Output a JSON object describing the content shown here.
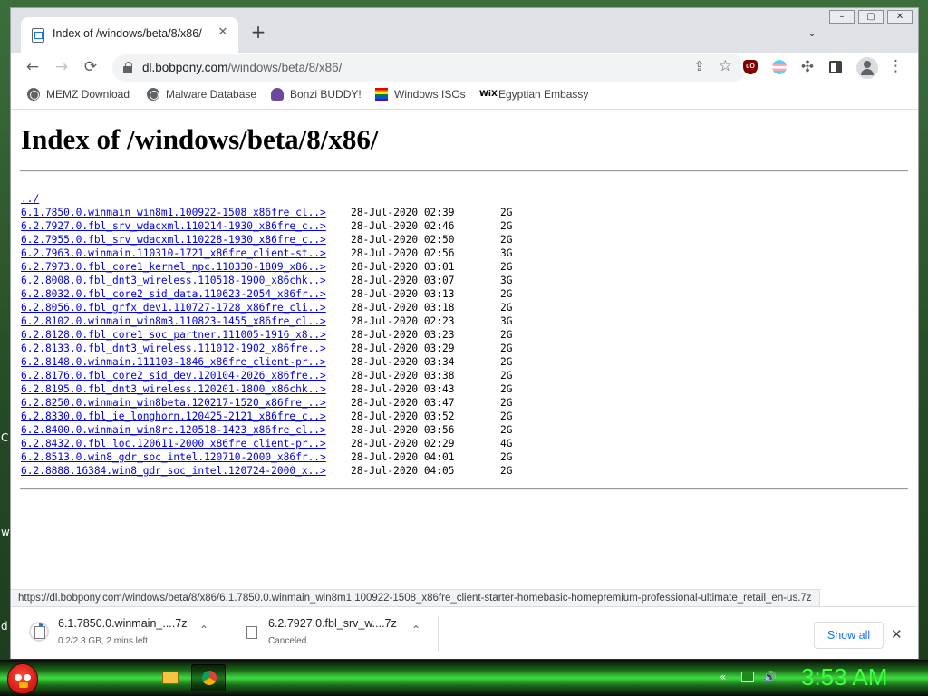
{
  "browser": {
    "tab": {
      "title": "Index of /windows/beta/8/x86/",
      "close": "✕"
    },
    "new_tab": "+",
    "tab_search": "⌄",
    "window_controls": {
      "minimize": "–",
      "maximize": "▢",
      "close": "✕"
    },
    "address": {
      "host": "dl.bobpony.com",
      "path": "/windows/beta/8/x86/"
    },
    "icons": {
      "back": "←",
      "forward": "→",
      "reload": "⟳",
      "share": "⇪",
      "star": "☆",
      "menu": "⋮",
      "puzzle": "✣"
    },
    "ublock_label": "uO",
    "bookmarks": [
      {
        "label": "MEMZ Download",
        "icon": "globe-icon"
      },
      {
        "label": "Malware Database",
        "icon": "globe-icon"
      },
      {
        "label": "Bonzi BUDDY!",
        "icon": "bonzi-icon"
      },
      {
        "label": "Windows ISOs",
        "icon": "rainbow-flag-icon"
      },
      {
        "label": "Egyptian Embassy",
        "icon": "wix-icon",
        "icon_text": "WiX"
      }
    ]
  },
  "page": {
    "heading": "Index of /windows/beta/8/x86/",
    "parent_link": "../",
    "files": [
      {
        "name": "6.1.7850.0.winmain_win8m1.100922-1508_x86fre_cl..>",
        "date": "28-Jul-2020 02:39",
        "size": "2G"
      },
      {
        "name": "6.2.7927.0.fbl_srv_wdacxml.110214-1930_x86fre_c..>",
        "date": "28-Jul-2020 02:46",
        "size": "2G"
      },
      {
        "name": "6.2.7955.0.fbl_srv_wdacxml.110228-1930_x86fre_c..>",
        "date": "28-Jul-2020 02:50",
        "size": "2G"
      },
      {
        "name": "6.2.7963.0.winmain.110310-1721_x86fre_client-st..>",
        "date": "28-Jul-2020 02:56",
        "size": "3G"
      },
      {
        "name": "6.2.7973.0.fbl_core1_kernel_npc.110330-1809_x86..>",
        "date": "28-Jul-2020 03:01",
        "size": "2G"
      },
      {
        "name": "6.2.8008.0.fbl_dnt3_wireless.110518-1900_x86chk..>",
        "date": "28-Jul-2020 03:07",
        "size": "3G"
      },
      {
        "name": "6.2.8032.0.fbl_core2_sid_data.110623-2054_x86fr..>",
        "date": "28-Jul-2020 03:13",
        "size": "2G"
      },
      {
        "name": "6.2.8056.0.fbl_grfx_dev1.110727-1728_x86fre_cli..>",
        "date": "28-Jul-2020 03:18",
        "size": "2G"
      },
      {
        "name": "6.2.8102.0.winmain_win8m3.110823-1455_x86fre_cl..>",
        "date": "28-Jul-2020 02:23",
        "size": "3G"
      },
      {
        "name": "6.2.8128.0.fbl_core1_soc_partner.111005-1916_x8..>",
        "date": "28-Jul-2020 03:23",
        "size": "2G"
      },
      {
        "name": "6.2.8133.0.fbl_dnt3_wireless.111012-1902_x86fre..>",
        "date": "28-Jul-2020 03:29",
        "size": "2G"
      },
      {
        "name": "6.2.8148.0.winmain.111103-1846_x86fre_client-pr..>",
        "date": "28-Jul-2020 03:34",
        "size": "2G"
      },
      {
        "name": "6.2.8176.0.fbl_core2_sid_dev.120104-2026_x86fre..>",
        "date": "28-Jul-2020 03:38",
        "size": "2G"
      },
      {
        "name": "6.2.8195.0.fbl_dnt3_wireless.120201-1800_x86chk..>",
        "date": "28-Jul-2020 03:43",
        "size": "2G"
      },
      {
        "name": "6.2.8250.0.winmain_win8beta.120217-1520_x86fre_..>",
        "date": "28-Jul-2020 03:47",
        "size": "2G"
      },
      {
        "name": "6.2.8330.0.fbl_ie_longhorn.120425-2121_x86fre_c..>",
        "date": "28-Jul-2020 03:52",
        "size": "2G"
      },
      {
        "name": "6.2.8400.0.winmain_win8rc.120518-1423_x86fre_cl..>",
        "date": "28-Jul-2020 03:56",
        "size": "2G"
      },
      {
        "name": "6.2.8432.0.fbl_loc.120611-2000_x86fre_client-pr..>",
        "date": "28-Jul-2020 02:29",
        "size": "4G"
      },
      {
        "name": "6.2.8513.0.win8_gdr_soc_intel.120710-2000_x86fr..>",
        "date": "28-Jul-2020 04:01",
        "size": "2G"
      },
      {
        "name": "6.2.8888.16384.win8_gdr_soc_intel.120724-2000_x..>",
        "date": "28-Jul-2020 04:05",
        "size": "2G"
      }
    ]
  },
  "status_url": "https://dl.bobpony.com/windows/beta/8/x86/6.1.7850.0.winmain_win8m1.100922-1508_x86fre_client-starter-homebasic-homepremium-professional-ultimate_retail_en-us.7z",
  "downloads": {
    "items": [
      {
        "name": "6.1.7850.0.winmain_....7z",
        "status": "0.2/2.3 GB, 2 mins left",
        "progress": 0.09
      },
      {
        "name": "6.2.7927.0.fbl_srv_w....7z",
        "status": "Canceled"
      }
    ],
    "chevron": "⌃",
    "show_all": "Show all",
    "close": "✕"
  },
  "desktop": {
    "edge_letters": [
      "C",
      "w",
      "d"
    ]
  },
  "taskbar": {
    "clock": "3:53 AM",
    "tray": {
      "back": "«",
      "volume": "🔊"
    }
  }
}
